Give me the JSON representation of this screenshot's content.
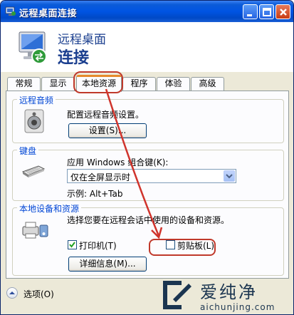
{
  "window": {
    "title": "远程桌面连接"
  },
  "banner": {
    "line1": "远程桌面",
    "line2": "连接"
  },
  "tabs": [
    {
      "label": "常规"
    },
    {
      "label": "显示"
    },
    {
      "label": "本地资源",
      "active": true
    },
    {
      "label": "程序"
    },
    {
      "label": "体验"
    },
    {
      "label": "高级"
    }
  ],
  "audio": {
    "group_title": "远程音频",
    "description": "配置远程音频设置。",
    "settings_button": "设置(S)..."
  },
  "keyboard": {
    "group_title": "键盘",
    "apply_label": "应用 Windows 组合键(K):",
    "selected_option": "仅在全屏显示时",
    "example": "示例: Alt+Tab"
  },
  "devices": {
    "group_title": "本地设备和资源",
    "description": "选择您要在远程会话中使用的设备和资源。",
    "printers_label": "打印机(T)",
    "printers_checked": true,
    "clipboard_label": "剪贴板(L)",
    "clipboard_checked": false,
    "details_button": "详细信息(M)..."
  },
  "footer": {
    "options_label": "选项(O)"
  },
  "watermark": {
    "text": "爱纯净",
    "url": "aichunjing.com"
  },
  "colors": {
    "annotation": "#d0342c",
    "title_bar": "#0054e3",
    "group_title": "#0046d5"
  }
}
